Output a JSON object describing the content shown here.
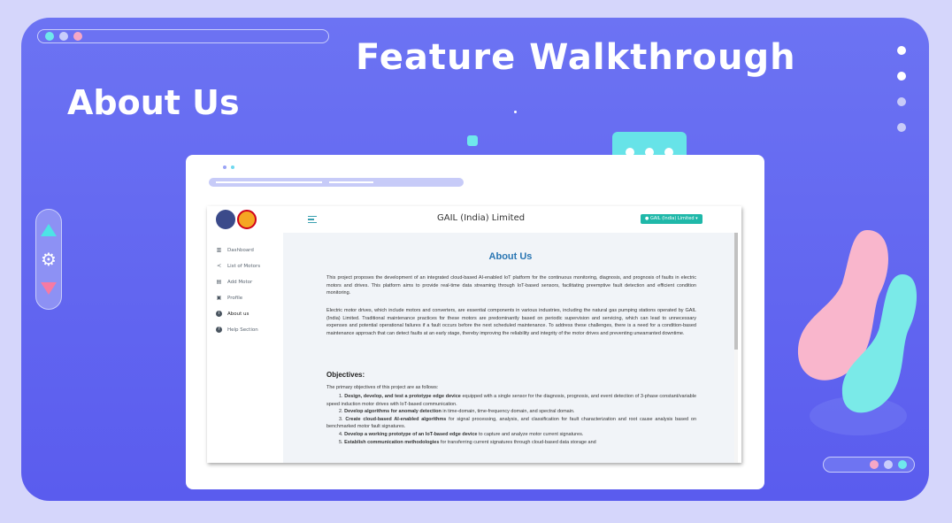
{
  "hero": {
    "title": "Feature Walkthrough",
    "subtitle": "About Us"
  },
  "colors": {
    "stage": "#5a5cee",
    "accent_cyan": "#67e3e8",
    "accent_pink": "#f67aa4",
    "title_blue": "#2a76b3",
    "button_teal": "#1fb8a9"
  },
  "app": {
    "title": "GAIL (India) Limited",
    "user_button": "GAIL (India) Limited",
    "sidebar": {
      "items": [
        {
          "label": "Dashboard",
          "icon": "chart-bar-icon"
        },
        {
          "label": "List of Motors",
          "icon": "motor-list-icon"
        },
        {
          "label": "Add Motor",
          "icon": "add-motor-icon"
        },
        {
          "label": "Profile",
          "icon": "profile-icon"
        },
        {
          "label": "About us",
          "icon": "info-icon"
        },
        {
          "label": "Help Section",
          "icon": "help-icon"
        }
      ]
    },
    "content": {
      "heading": "About Us",
      "paragraph1": "This project proposes the development of an integrated cloud-based AI-enabled IoT platform for the continuous monitoring, diagnosis, and prognosis of faults in electric motors and drives. This platform aims to provide real-time data streaming through IoT-based sensors, facilitating preemptive fault detection and efficient condition monitoring.",
      "paragraph2": "Electric motor drives, which include motors and converters, are essential components in various industries, including the natural gas pumping stations operated by GAIL (India) Limited. Traditional maintenance practices for these motors are predominantly based on periodic supervision and servicing, which can lead to unnecessary expenses and potential operational failures if a fault occurs before the next scheduled maintenance. To address these challenges, there is a need for a condition-based maintenance approach that can detect faults at an early stage, thereby improving the reliability and integrity of the motor drives and preventing unwarranted downtime.",
      "objectives_heading": "Objectives:",
      "objectives_intro": "The primary objectives of this project are as follows:",
      "objectives": [
        {
          "num": "1.",
          "bold": "Design, develop, and test a prototype edge device",
          "rest": " equipped with a single sensor for the diagnosis, prognosis, and event detection of 3-phase constant/variable speed induction motor drives with IoT-based communication."
        },
        {
          "num": "2.",
          "bold": "Develop algorithms for anomaly detection",
          "rest": " in time-domain, time-frequency domain, and spectral domain."
        },
        {
          "num": "3.",
          "bold": "Create cloud-based AI-enabled algorithms",
          "rest": " for signal processing, analysis, and classification for fault characterization and root cause analysis based on benchmarked motor fault signatures."
        },
        {
          "num": "4.",
          "bold": "Develop a working prototype of an IoT-based edge device",
          "rest": " to capture and analyze motor current signatures."
        },
        {
          "num": "5.",
          "bold": "Establish communication methodologies",
          "rest": " for transferring current signatures through cloud-based data storage and"
        }
      ]
    }
  }
}
